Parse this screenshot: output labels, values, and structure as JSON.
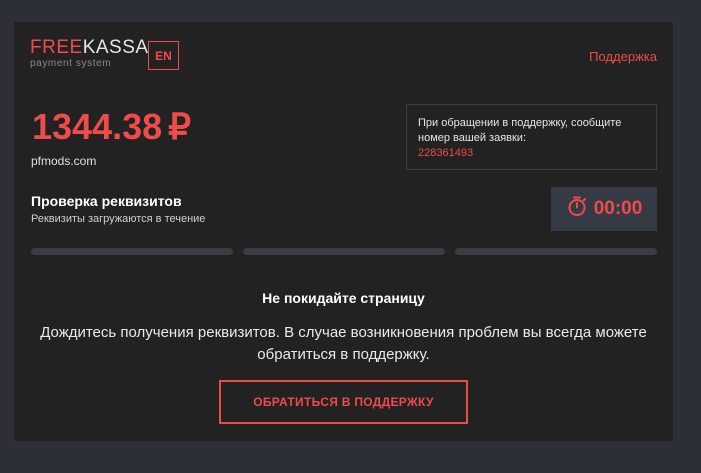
{
  "logo": {
    "brand_part1": "FREE",
    "brand_part2": "KASSA",
    "tagline": "payment system"
  },
  "header": {
    "lang_label": "EN",
    "support_label": "Поддержка"
  },
  "payment": {
    "amount": "1344.38",
    "currency_symbol": "₽",
    "merchant": "pfmods.com"
  },
  "notice": {
    "text": "При обращении в поддержку, сообщите номер вашей заявки:",
    "order_id": "228361493"
  },
  "verification": {
    "title": "Проверка реквизитов",
    "subtitle": "Реквизиты загружаются в течение",
    "timer": "00:00",
    "progress_segments": [
      0,
      0,
      0
    ]
  },
  "message": {
    "title": "Не покидайте страницу",
    "body": "Дождитесь получения реквизитов. В случае возникновения проблем вы всегда можете обратиться в поддержку.",
    "button_label": "ОБРАТИТЬСЯ В ПОДДЕРЖКУ"
  },
  "icons": {
    "timer": "stopwatch-icon"
  },
  "colors": {
    "accent": "#ee4b4b",
    "card_bg": "#222222",
    "page_bg": "#2c2f36",
    "timer_bg": "#363a44"
  }
}
